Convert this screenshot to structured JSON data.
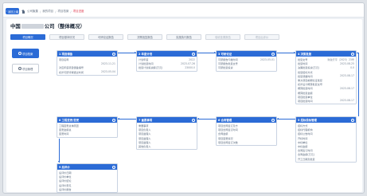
{
  "nav": {
    "back_label": "返回上级",
    "breadcrumbs": [
      "公司聚集",
      "我的项目",
      "项目档案",
      "项目进度"
    ]
  },
  "page": {
    "title_prefix": "中国",
    "title_suffix": "公司（整体概况）"
  },
  "tabs": [
    {
      "label": "项目概况",
      "active": true,
      "disabled": false
    },
    {
      "label": "项目基本情况",
      "active": false,
      "disabled": false
    },
    {
      "label": "可研论证报告",
      "active": false,
      "disabled": false
    },
    {
      "label": "决策批复报告",
      "active": false,
      "disabled": false
    },
    {
      "label": "实施执行报告",
      "active": false,
      "disabled": false
    },
    {
      "label": "验收处置报告",
      "active": false,
      "disabled": true
    },
    {
      "label": "项目后评价",
      "active": false,
      "disabled": true
    }
  ],
  "side": {
    "primary_label": "项目档案",
    "secondary_label": "项目管理"
  },
  "cards": {
    "c1": {
      "title": "1 项目储备",
      "rows": [
        {
          "k": "项目名称",
          "v": ""
        },
        {
          "k": "",
          "v": "2023-11-21"
        },
        {
          "k": "对应年度项目储备编号",
          "v": ""
        },
        {
          "k": "初步可研评审通过时间",
          "v": "2023-05-04"
        }
      ]
    },
    "c2": {
      "title": "2 年度计划",
      "rows": [
        {
          "k": "计划年度",
          "v": "2022"
        },
        {
          "k": "计划批复时间",
          "v": "2023-07-26"
        },
        {
          "k": "批复计划投资额(万元)",
          "v": "23000.0"
        }
      ]
    },
    "c3": {
      "title": "3 可研论证",
      "rows": [
        {
          "k": "可研报告印发时间",
          "v": "2023-05-01"
        },
        {
          "k": "可研报告批复文号",
          "v": ""
        },
        {
          "k": "可研批复投资",
          "v": ""
        }
      ]
    },
    "c4": {
      "title": "4 决策批复",
      "rows": [
        {
          "k": "批复文号",
          "v": "财政厅字〔2023〕23号"
        },
        {
          "k": "批复时间",
          "v": "2023-08-25"
        },
        {
          "k": "决策批复投资(万元)",
          "v": "0.0"
        },
        {
          "k": "批复招标方式",
          "v": ""
        },
        {
          "k": "批复调整时间",
          "v": "2023-08-17"
        },
        {
          "k": "重大项目前期论证批复",
          "v": ""
        },
        {
          "k": "初步设计概算批复文号",
          "v": ""
        },
        {
          "k": "概算批复时间",
          "v": "2023-08-17"
        },
        {
          "k": "概算批复金额",
          "v": ""
        },
        {
          "k": "项目批复单位",
          "v": ""
        },
        {
          "k": "项目批复时间",
          "v": "2023-08-17"
        }
      ]
    },
    "c5": {
      "title": "5 招标投标管理",
      "rows": [
        {
          "k": "招标方式",
          "v": ""
        },
        {
          "k": "招标代理机构",
          "v": ""
        },
        {
          "k": "招标公告时间",
          "v": ""
        },
        {
          "k": "开标时间",
          "v": ""
        },
        {
          "k": "中标单位",
          "v": ""
        },
        {
          "k": "中标金额",
          "v": ""
        },
        {
          "k": "合同签订时间",
          "v": ""
        },
        {
          "k": "合同金额(万元)",
          "v": ""
        },
        {
          "k": "开工日期及批复",
          "v": ""
        }
      ]
    },
    "c6": {
      "title": "6 合同管理",
      "rows": [
        {
          "k": "项目合同签订及方",
          "v": ""
        },
        {
          "k": "项目合同签订时间",
          "v": ""
        },
        {
          "k": "合同金额",
          "v": ""
        },
        {
          "k": "项目变更情况",
          "v": ""
        },
        {
          "k": "项目合同签订次数",
          "v": ""
        }
      ]
    },
    "c7": {
      "title": "7 重要事项",
      "rows": [
        {
          "k": "重要事项",
          "v": ""
        },
        {
          "k": "项目负责人",
          "v": ""
        },
        {
          "k": "项目监理人",
          "v": ""
        },
        {
          "k": "项目监理人",
          "v": ""
        },
        {
          "k": "项目监理人",
          "v": ""
        },
        {
          "k": "其他负责人",
          "v": ""
        }
      ]
    },
    "c8": {
      "title": "8 工程变更/变更",
      "rows": [
        {
          "k": "工程变更总体原因",
          "v": ""
        },
        {
          "k": "变更金额总",
          "v": ""
        },
        {
          "k": "变更时间",
          "v": ""
        }
      ]
    },
    "c9": {
      "title": "9 后评价",
      "rows": [
        {
          "k": "后评价日期",
          "v": ""
        },
        {
          "k": "后评价单位",
          "v": ""
        },
        {
          "k": "后评价结论",
          "v": ""
        },
        {
          "k": "后评价意见",
          "v": ""
        },
        {
          "k": "后评价报告",
          "v": ""
        }
      ]
    }
  }
}
